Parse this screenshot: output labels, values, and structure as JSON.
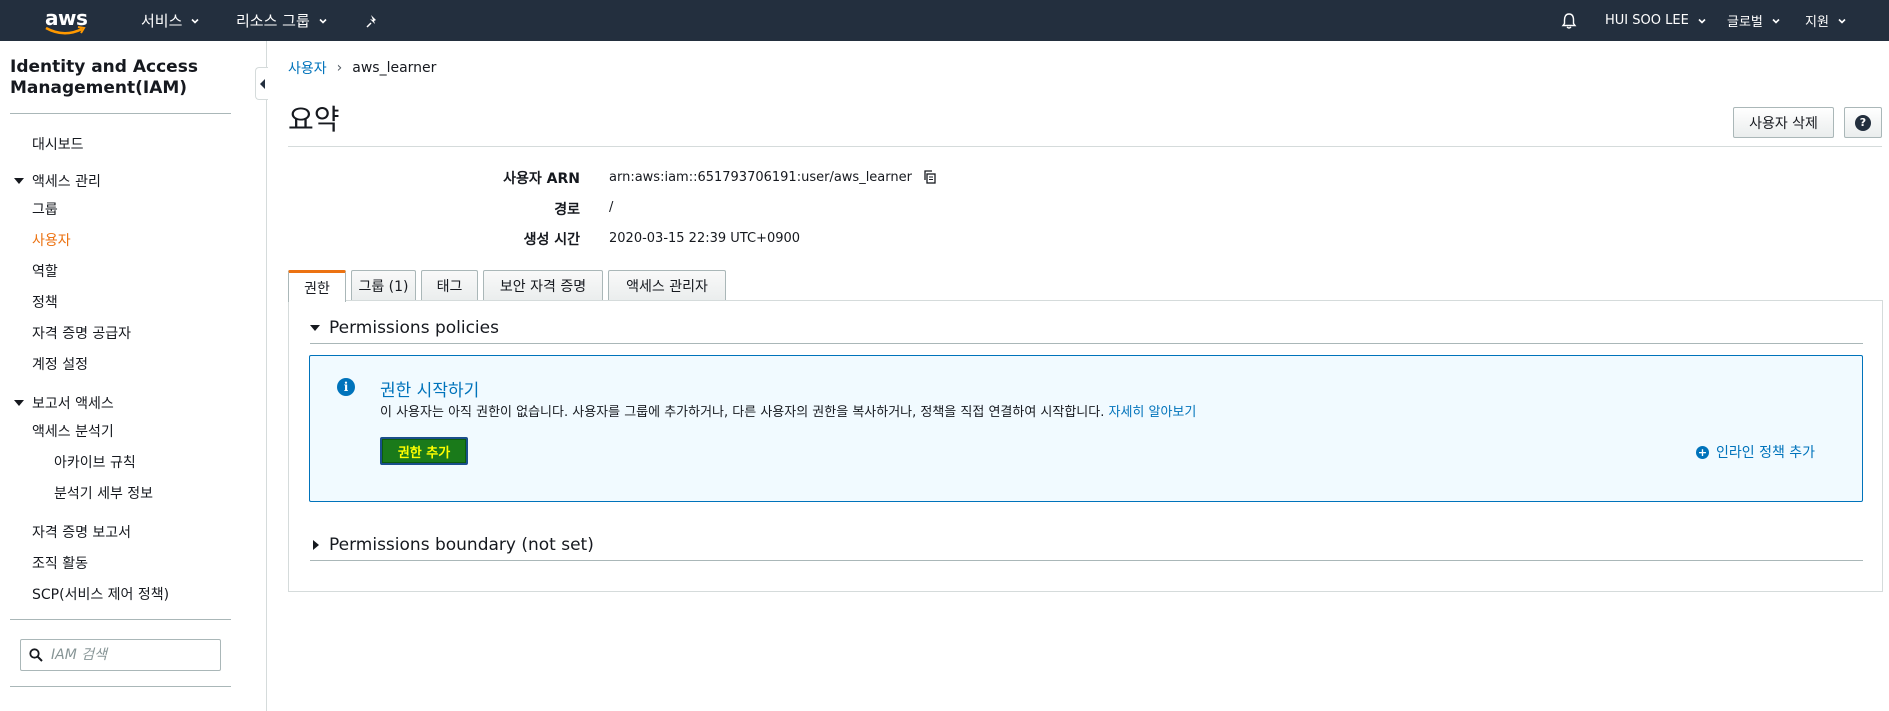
{
  "topnav": {
    "logo_text": "aws",
    "services_label": "서비스",
    "resource_groups_label": "리소스 그룹",
    "user_label": "HUI SOO LEE",
    "region_label": "글로벌",
    "support_label": "지원"
  },
  "sidebar": {
    "title": "Identity and Access Management(IAM)",
    "dashboard": "대시보드",
    "access_mgmt_section": "액세스 관리",
    "groups": "그룹",
    "users": "사용자",
    "roles": "역할",
    "policies": "정책",
    "identity_providers": "자격 증명 공급자",
    "account_settings": "계정 설정",
    "reports_section": "보고서 액세스",
    "access_analyzer": "액세스 분석기",
    "archive_rules": "아카이브 규칙",
    "analyzer_details": "분석기 세부 정보",
    "credential_report": "자격 증명 보고서",
    "org_activity": "조직 활동",
    "scp": "SCP(서비스 제어 정책)",
    "search_placeholder": "IAM 검색"
  },
  "breadcrumb": {
    "parent": "사용자",
    "current": "aws_learner"
  },
  "page": {
    "title": "요약",
    "delete_button": "사용자 삭제",
    "help_button": "?"
  },
  "summary": {
    "arn_label": "사용자 ARN",
    "arn_value": "arn:aws:iam::651793706191:user/aws_learner",
    "path_label": "경로",
    "path_value": "/",
    "created_label": "생성 시간",
    "created_value": "2020-03-15 22:39 UTC+0900"
  },
  "tabs": [
    {
      "label": "권한"
    },
    {
      "label": "그룹 (1)"
    },
    {
      "label": "태그"
    },
    {
      "label": "보안 자격 증명"
    },
    {
      "label": "액세스 관리자"
    }
  ],
  "permissions": {
    "policies_header": "Permissions policies",
    "info_title": "권한 시작하기",
    "info_text": "이 사용자는 아직 권한이 없습니다. 사용자를 그룹에 추가하거나, 다른 사용자의 권한을 복사하거나, 정책을 직접 연결하여 시작합니다.",
    "learn_more": "자세히 알아보기",
    "add_permissions_button": "권한 추가",
    "add_inline_policy": "인라인 정책 추가",
    "boundary_header": "Permissions boundary (not set)"
  },
  "colors": {
    "nav_bg": "#232f3e",
    "accent_orange": "#ec7211",
    "link_blue": "#0073bb",
    "info_bg": "#f1faff"
  }
}
